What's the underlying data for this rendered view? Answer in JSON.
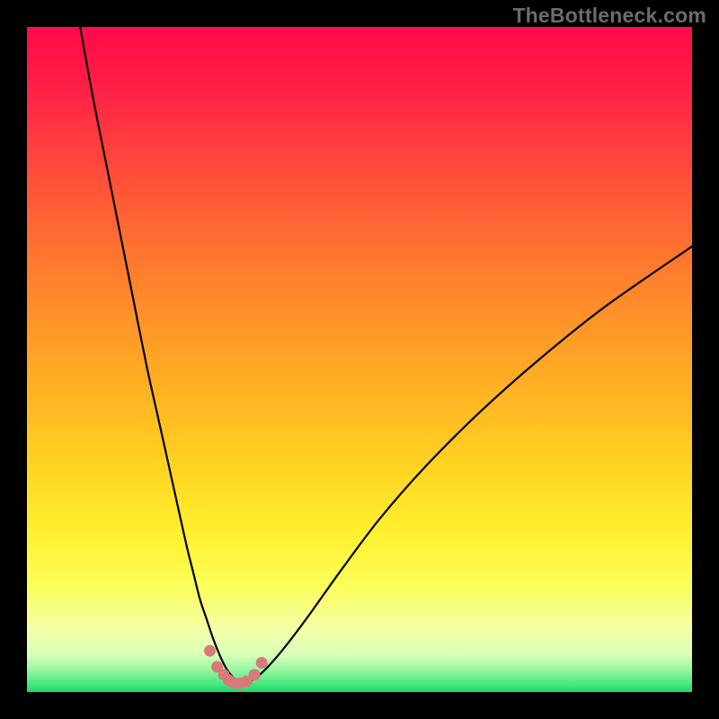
{
  "watermark": {
    "text": "TheBottleneck.com"
  },
  "colors": {
    "frame": "#000000",
    "curve": "#000000",
    "points": "#d87a7a",
    "gradient_stops": [
      {
        "offset": 0.0,
        "color": "#ff0a4a"
      },
      {
        "offset": 0.09,
        "color": "#ff1f47"
      },
      {
        "offset": 0.22,
        "color": "#ff4d3a"
      },
      {
        "offset": 0.37,
        "color": "#ff7e2d"
      },
      {
        "offset": 0.52,
        "color": "#ffab24"
      },
      {
        "offset": 0.66,
        "color": "#ffd321"
      },
      {
        "offset": 0.76,
        "color": "#fff02e"
      },
      {
        "offset": 0.84,
        "color": "#fbff5a"
      },
      {
        "offset": 0.905,
        "color": "#f4ffa6"
      },
      {
        "offset": 0.945,
        "color": "#d6ffb9"
      },
      {
        "offset": 0.97,
        "color": "#8bf59a"
      },
      {
        "offset": 0.99,
        "color": "#3fe77f"
      },
      {
        "offset": 1.0,
        "color": "#1fd668"
      }
    ]
  },
  "chart_data": {
    "type": "line",
    "title": "",
    "xlabel": "",
    "ylabel": "",
    "xlim": [
      0,
      100
    ],
    "ylim": [
      0,
      100
    ],
    "series": [
      {
        "name": "bottleneck-curve",
        "x": [
          8,
          10,
          12,
          14,
          16,
          18,
          20,
          22,
          24,
          25,
          26,
          27,
          28,
          29,
          30,
          31,
          32,
          33,
          35,
          38,
          42,
          47,
          53,
          60,
          68,
          77,
          87,
          100
        ],
        "y": [
          100,
          89,
          79,
          69,
          59,
          49,
          40,
          31,
          22,
          18,
          14,
          11,
          8,
          5.5,
          3.5,
          2.2,
          1.4,
          1.4,
          2.6,
          5.8,
          11,
          18,
          26,
          34,
          42,
          50,
          58,
          67
        ]
      }
    ],
    "scatter_points": {
      "name": "near-minimum-points",
      "x": [
        27.5,
        28.6,
        29.6,
        30.3,
        31.0,
        32.0,
        33.0,
        34.2,
        35.3
      ],
      "y": [
        6.2,
        3.8,
        2.6,
        1.8,
        1.4,
        1.3,
        1.6,
        2.6,
        4.4
      ]
    }
  }
}
